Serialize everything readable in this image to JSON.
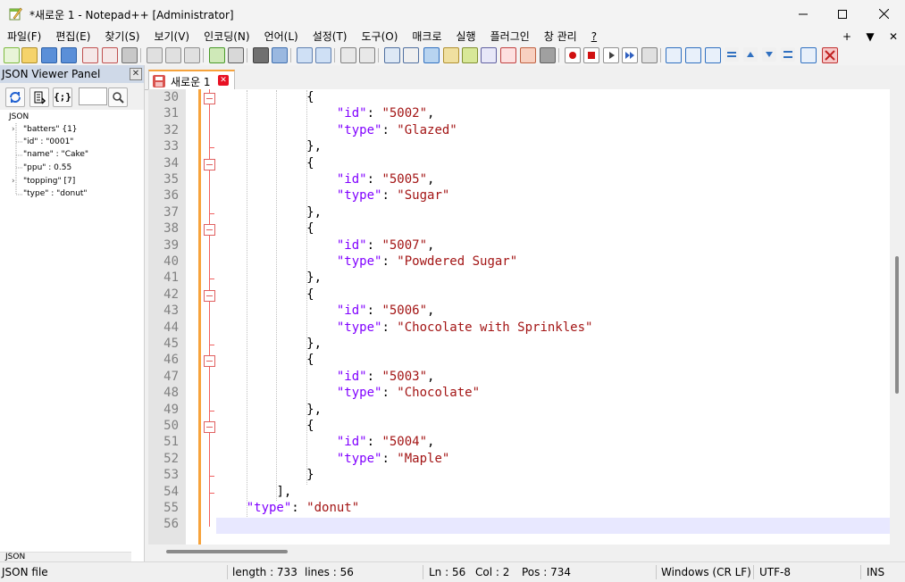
{
  "window": {
    "title": "*새로운 1 - Notepad++ [Administrator]",
    "controls": {
      "minimize": "—",
      "maximize": "☐",
      "close": "✕"
    }
  },
  "menu": {
    "items": [
      "파일(F)",
      "편집(E)",
      "찾기(S)",
      "보기(V)",
      "인코딩(N)",
      "언어(L)",
      "설정(T)",
      "도구(O)",
      "매크로",
      "실행",
      "플러그인",
      "창 관리",
      "?"
    ],
    "right": [
      "+",
      "▼",
      "✕"
    ]
  },
  "panel": {
    "title": "JSON Viewer Panel",
    "close": "✕",
    "tools": [
      "refresh-icon",
      "format-icon",
      "braces-icon",
      "search-icon"
    ],
    "braces_label": "{;}",
    "tree_root": "JSON",
    "tree_items": [
      {
        "label": "\"batters\" {1}",
        "expandable": true
      },
      {
        "label": "\"id\" : \"0001\"",
        "expandable": false
      },
      {
        "label": "\"name\" : \"Cake\"",
        "expandable": false
      },
      {
        "label": "\"ppu\" : 0.55",
        "expandable": false
      },
      {
        "label": "\"topping\" [7]",
        "expandable": true
      },
      {
        "label": "\"type\" : \"donut\"",
        "expandable": false
      }
    ],
    "footer": "JSON"
  },
  "tab": {
    "label": "새로운 1",
    "close": "✕"
  },
  "editor": {
    "line_numbers": [
      "30",
      "31",
      "32",
      "33",
      "34",
      "35",
      "36",
      "37",
      "38",
      "39",
      "40",
      "41",
      "42",
      "43",
      "44",
      "45",
      "46",
      "47",
      "48",
      "49",
      "50",
      "51",
      "52",
      "53",
      "54",
      "55",
      "56"
    ],
    "lines": [
      {
        "indent": "            ",
        "parts": [
          {
            "t": "p",
            "v": "{"
          }
        ]
      },
      {
        "indent": "                ",
        "parts": [
          {
            "t": "k",
            "v": "\"id\""
          },
          {
            "t": "p",
            "v": ": "
          },
          {
            "t": "s",
            "v": "\"5002\""
          },
          {
            "t": "p",
            "v": ","
          }
        ]
      },
      {
        "indent": "                ",
        "parts": [
          {
            "t": "k",
            "v": "\"type\""
          },
          {
            "t": "p",
            "v": ": "
          },
          {
            "t": "s",
            "v": "\"Glazed\""
          }
        ]
      },
      {
        "indent": "            ",
        "parts": [
          {
            "t": "p",
            "v": "},"
          }
        ]
      },
      {
        "indent": "            ",
        "parts": [
          {
            "t": "p",
            "v": "{"
          }
        ]
      },
      {
        "indent": "                ",
        "parts": [
          {
            "t": "k",
            "v": "\"id\""
          },
          {
            "t": "p",
            "v": ": "
          },
          {
            "t": "s",
            "v": "\"5005\""
          },
          {
            "t": "p",
            "v": ","
          }
        ]
      },
      {
        "indent": "                ",
        "parts": [
          {
            "t": "k",
            "v": "\"type\""
          },
          {
            "t": "p",
            "v": ": "
          },
          {
            "t": "s",
            "v": "\"Sugar\""
          }
        ]
      },
      {
        "indent": "            ",
        "parts": [
          {
            "t": "p",
            "v": "},"
          }
        ]
      },
      {
        "indent": "            ",
        "parts": [
          {
            "t": "p",
            "v": "{"
          }
        ]
      },
      {
        "indent": "                ",
        "parts": [
          {
            "t": "k",
            "v": "\"id\""
          },
          {
            "t": "p",
            "v": ": "
          },
          {
            "t": "s",
            "v": "\"5007\""
          },
          {
            "t": "p",
            "v": ","
          }
        ]
      },
      {
        "indent": "                ",
        "parts": [
          {
            "t": "k",
            "v": "\"type\""
          },
          {
            "t": "p",
            "v": ": "
          },
          {
            "t": "s",
            "v": "\"Powdered Sugar\""
          }
        ]
      },
      {
        "indent": "            ",
        "parts": [
          {
            "t": "p",
            "v": "},"
          }
        ]
      },
      {
        "indent": "            ",
        "parts": [
          {
            "t": "p",
            "v": "{"
          }
        ]
      },
      {
        "indent": "                ",
        "parts": [
          {
            "t": "k",
            "v": "\"id\""
          },
          {
            "t": "p",
            "v": ": "
          },
          {
            "t": "s",
            "v": "\"5006\""
          },
          {
            "t": "p",
            "v": ","
          }
        ]
      },
      {
        "indent": "                ",
        "parts": [
          {
            "t": "k",
            "v": "\"type\""
          },
          {
            "t": "p",
            "v": ": "
          },
          {
            "t": "s",
            "v": "\"Chocolate with Sprinkles\""
          }
        ]
      },
      {
        "indent": "            ",
        "parts": [
          {
            "t": "p",
            "v": "},"
          }
        ]
      },
      {
        "indent": "            ",
        "parts": [
          {
            "t": "p",
            "v": "{"
          }
        ]
      },
      {
        "indent": "                ",
        "parts": [
          {
            "t": "k",
            "v": "\"id\""
          },
          {
            "t": "p",
            "v": ": "
          },
          {
            "t": "s",
            "v": "\"5003\""
          },
          {
            "t": "p",
            "v": ","
          }
        ]
      },
      {
        "indent": "                ",
        "parts": [
          {
            "t": "k",
            "v": "\"type\""
          },
          {
            "t": "p",
            "v": ": "
          },
          {
            "t": "s",
            "v": "\"Chocolate\""
          }
        ]
      },
      {
        "indent": "            ",
        "parts": [
          {
            "t": "p",
            "v": "},"
          }
        ]
      },
      {
        "indent": "            ",
        "parts": [
          {
            "t": "p",
            "v": "{"
          }
        ]
      },
      {
        "indent": "                ",
        "parts": [
          {
            "t": "k",
            "v": "\"id\""
          },
          {
            "t": "p",
            "v": ": "
          },
          {
            "t": "s",
            "v": "\"5004\""
          },
          {
            "t": "p",
            "v": ","
          }
        ]
      },
      {
        "indent": "                ",
        "parts": [
          {
            "t": "k",
            "v": "\"type\""
          },
          {
            "t": "p",
            "v": ": "
          },
          {
            "t": "s",
            "v": "\"Maple\""
          }
        ]
      },
      {
        "indent": "            ",
        "parts": [
          {
            "t": "p",
            "v": "}"
          }
        ]
      },
      {
        "indent": "        ",
        "parts": [
          {
            "t": "p",
            "v": "],"
          }
        ]
      },
      {
        "indent": "    ",
        "parts": [
          {
            "t": "k",
            "v": "\"type\""
          },
          {
            "t": "p",
            "v": ": "
          },
          {
            "t": "s",
            "v": "\"donut\""
          }
        ]
      },
      {
        "indent": "",
        "parts": []
      }
    ],
    "fold_lines": [
      "30",
      "34",
      "38",
      "42",
      "46",
      "50"
    ],
    "current_line": "56"
  },
  "status": {
    "file_type": "JSON file",
    "length": "length : 733",
    "lines": "lines : 56",
    "ln": "Ln : 56",
    "col": "Col : 2",
    "pos": "Pos : 734",
    "eol": "Windows (CR LF)",
    "encoding": "UTF-8",
    "mode": "INS"
  },
  "colors": {
    "keyword": "#8000ff",
    "string": "#a31515",
    "margin_accent": "#f7a33b",
    "fold_line": "#f06060",
    "current_line_bg": "#e8e8ff"
  }
}
